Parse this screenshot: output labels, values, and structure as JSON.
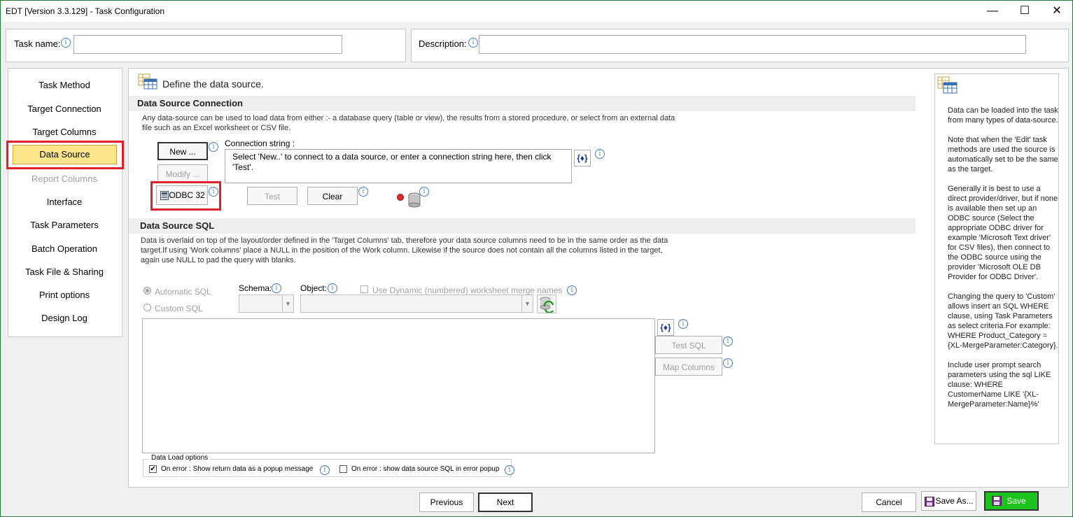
{
  "window": {
    "title": "EDT [Version 3.3.129] - Task Configuration",
    "minimize": "—",
    "maximize": "☐",
    "close": "✕"
  },
  "header": {
    "task_name_label": "Task name:",
    "task_name_value": "",
    "description_label": "Description:",
    "description_value": ""
  },
  "sidebar": {
    "items": [
      {
        "label": "Task Method"
      },
      {
        "label": "Target Connection"
      },
      {
        "label": "Target Columns"
      },
      {
        "label": "Data Source"
      },
      {
        "label": "Report Columns"
      },
      {
        "label": "Interface"
      },
      {
        "label": "Task Parameters"
      },
      {
        "label": "Batch Operation"
      },
      {
        "label": "Task File & Sharing"
      },
      {
        "label": "Print options"
      },
      {
        "label": "Design Log"
      }
    ],
    "selected": "Data Source"
  },
  "main": {
    "heading": "Define the data source.",
    "connection": {
      "section_title": "Data Source Connection",
      "desc_line1": "Any data-source can be used to load data from either :- a database query (table or view), the results from a stored procedure, or select from an external data",
      "desc_line2": "file such as an Excel worksheet or CSV file.",
      "new_button": "New ...",
      "modify_button": "Modify ...",
      "odbc_button": "ODBC 32",
      "connection_string_label": "Connection string :",
      "connection_string_line1": "Select 'New..' to connect to a data source, or enter a connection string here, then click",
      "connection_string_line2": "'Test'.",
      "brace_button": "{♦}",
      "test_button": "Test",
      "clear_button": "Clear"
    },
    "sql": {
      "section_title": "Data Source SQL",
      "desc_line1": "Data is overlaid on top of the layout/order defined in the 'Target Columns' tab,  therefore your data source columns need to be in the same order as the data",
      "desc_line2": "target.If using 'Work columns' place a NULL in the position of the Work column.  Likewise if the source does not contain all the columns listed in the target,",
      "desc_line3": "again use NULL to pad the query with blanks.",
      "automatic_sql": "Automatic SQL",
      "custom_sql": "Custom SQL",
      "schema_label": "Schema:",
      "object_label": "Object:",
      "dynamic_label": "Use Dynamic (numbered) worksheet merge names",
      "query_text": "",
      "brace_button": "{♦}",
      "test_sql_button": "Test SQL",
      "map_columns_button": "Map Columns"
    },
    "load_options": {
      "group_title": "Data Load options",
      "popup_label": "On error : Show return data as a popup message",
      "popup_checked": true,
      "sql_label": "On error : show data source SQL in error popup",
      "sql_checked": false
    }
  },
  "help": {
    "p1": "Data can be loaded into the task from many types of data-source.",
    "p2": "Note that when the 'Edit' task methods are used the source is automatically set to be the same as the target.",
    "p3": "Generally it is best to use a direct provider/driver, but if none is available then set up an ODBC source (Select the appropriate ODBC driver for example 'Microsoft Text driver' for CSV files), then connect to the ODBC source using the provider 'Microsoft OLE DB Provider for ODBC Driver'.",
    "p4": "Changing the query to 'Custom' allows insert an SQL WHERE clause, using Task Parameters as select criteria.For example: WHERE Product_Category = {XL-MergeParameter:Category}.",
    "p5": "Include user prompt search parameters using the sql LIKE clause: WHERE CustomerName LIKE '{XL-MergeParameter:Name}%'"
  },
  "footer": {
    "previous": "Previous",
    "next": "Next",
    "cancel": "Cancel",
    "save_as": "Save As...",
    "save": "Save"
  },
  "colors": {
    "selected_bg": "#fde58c",
    "highlight_border": "#e0202a",
    "save_bg": "#1ec41e",
    "window_border": "#1e7e34"
  }
}
